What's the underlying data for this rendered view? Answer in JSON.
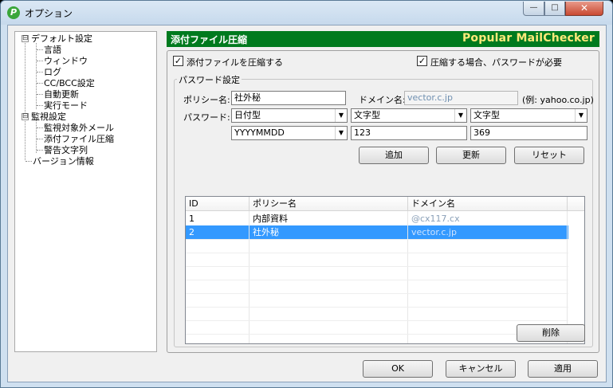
{
  "window": {
    "title": "オプション",
    "app_icon_glyph": "P",
    "minimize_glyph": "—",
    "maximize_glyph": "□",
    "close_glyph": "✕"
  },
  "tree": {
    "items": [
      {
        "label": "デフォルト設定",
        "expander": "⊟"
      },
      {
        "label": "言語"
      },
      {
        "label": "ウィンドウ"
      },
      {
        "label": "ログ"
      },
      {
        "label": "CC/BCC設定"
      },
      {
        "label": "自動更新"
      },
      {
        "label": "実行モード"
      },
      {
        "label": "監視設定",
        "expander": "⊟"
      },
      {
        "label": "監視対象外メール"
      },
      {
        "label": "添付ファイル圧縮"
      },
      {
        "label": "警告文字列"
      },
      {
        "label": "バージョン情報"
      }
    ]
  },
  "header": {
    "title": "添付ファイル圧縮",
    "brand": "Popular MailChecker",
    "bar_color": "#007a1e",
    "brand_color": "#ffe97a"
  },
  "options": {
    "compress_label": "添付ファイルを圧縮する",
    "compress_checked": "✓",
    "password_required_label": "圧縮する場合、パスワードが必要",
    "password_required_checked": "✓"
  },
  "password_settings": {
    "group_title": "パスワード設定",
    "policy_name_label": "ポリシー名:",
    "policy_name_value": "社外秘",
    "domain_label": "ドメイン名:",
    "domain_value": "vector.c.jp",
    "domain_hint": "(例: yahoo.co.jp)",
    "password_label": "パスワード:",
    "combo1_value": "日付型",
    "combo2_value": "文字型",
    "combo3_value": "文字型",
    "combo4_value": "YYYYMMDD",
    "text1_value": "123",
    "text2_value": "369",
    "add_button": "追加",
    "update_button": "更新",
    "reset_button": "リセット",
    "dropdown_glyph": "▼"
  },
  "policy_list": {
    "columns": [
      "ID",
      "ポリシー名",
      "ドメイン名"
    ],
    "rows": [
      {
        "id": "1",
        "policy": "内部資料",
        "domain": "@cx117.cx",
        "selected": false
      },
      {
        "id": "2",
        "policy": "社外秘",
        "domain": "vector.c.jp",
        "selected": true
      }
    ],
    "selection_color": "#3399ff"
  },
  "delete_button": "削除",
  "footer": {
    "ok_button": "OK",
    "cancel_button": "キャンセル",
    "apply_button": "適用"
  }
}
